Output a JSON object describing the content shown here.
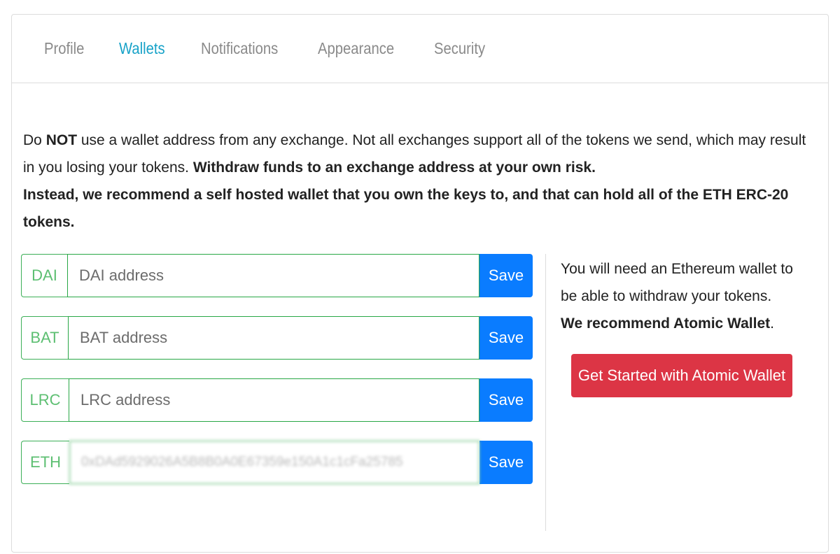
{
  "tabs": [
    {
      "label": "Profile",
      "active": false
    },
    {
      "label": "Wallets",
      "active": true
    },
    {
      "label": "Notifications",
      "active": false
    },
    {
      "label": "Appearance",
      "active": false
    },
    {
      "label": "Security",
      "active": false
    }
  ],
  "notice": {
    "part1": "Do ",
    "part2_bold": "NOT",
    "part3": " use a wallet address from any exchange. Not all exchanges support all of the tokens we send, which may result in you losing your tokens. ",
    "part4_bold": "Withdraw funds to an exchange address at your own risk.",
    "part5_bold": "Instead, we recommend a self hosted wallet that you own the keys to, and that can hold all of the ETH ERC-20 tokens."
  },
  "wallets": [
    {
      "token": "DAI",
      "placeholder": "DAI address",
      "value": "",
      "save_label": "Save"
    },
    {
      "token": "BAT",
      "placeholder": "BAT address",
      "value": "",
      "save_label": "Save"
    },
    {
      "token": "LRC",
      "placeholder": "LRC address",
      "value": "",
      "save_label": "Save"
    },
    {
      "token": "ETH",
      "placeholder": "",
      "value": "0xDAd5929026A5B8B0A0E67359e150A1c1cFa25785",
      "save_label": "Save"
    }
  ],
  "side": {
    "text": "You will need an Ethereum wallet to be able to withdraw your tokens.",
    "recommend_bold": "We recommend Atomic Wallet",
    "recommend_end": ".",
    "button_label": "Get Started with Atomic Wallet"
  },
  "colors": {
    "active_tab": "#17a2c8",
    "inactive_tab": "#8a8a8a",
    "input_border": "#28a745",
    "save_button": "#0a7cff",
    "atomic_button": "#dc3545"
  }
}
